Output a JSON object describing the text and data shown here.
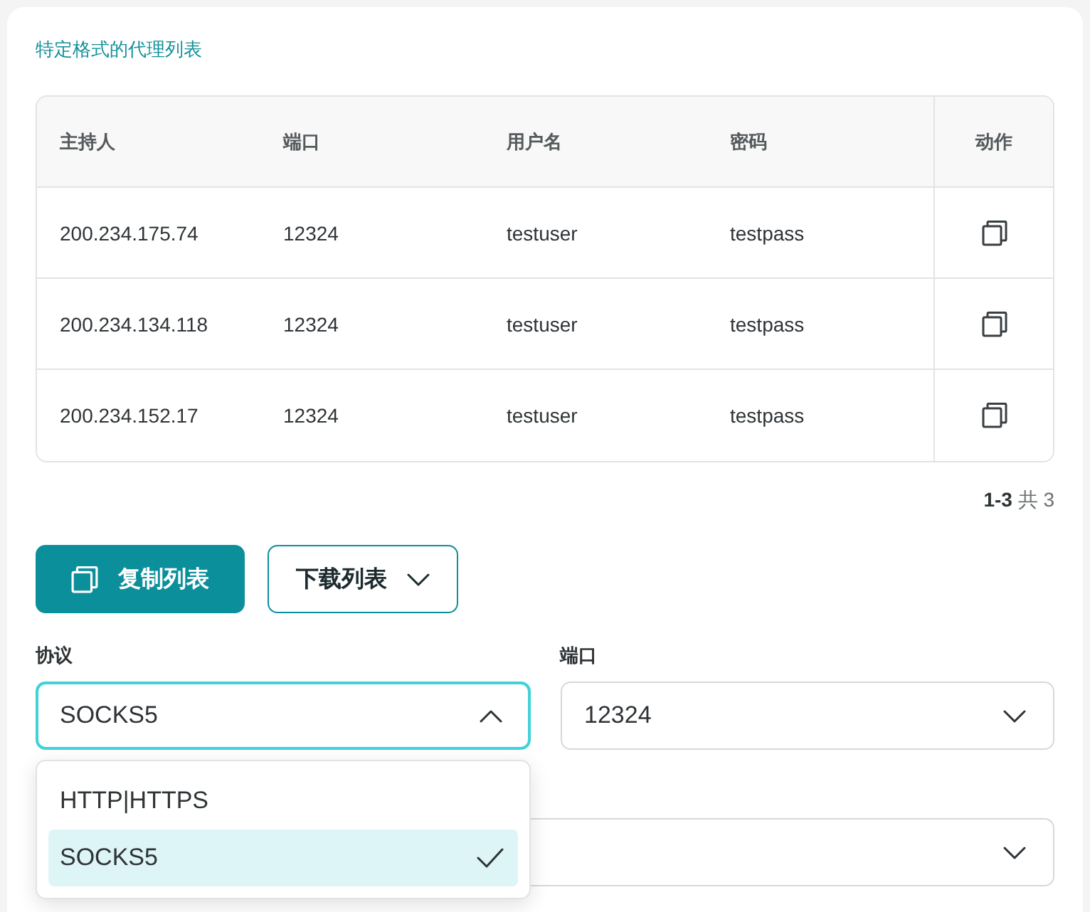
{
  "section_title": "特定格式的代理列表",
  "table": {
    "columns": [
      "主持人",
      "端口",
      "用户名",
      "密码",
      "动作"
    ],
    "rows": [
      {
        "cells": [
          "200.234.175.74",
          "12324",
          "testuser",
          "testpass"
        ]
      },
      {
        "cells": [
          "200.234.134.118",
          "12324",
          "testuser",
          "testpass"
        ]
      },
      {
        "cells": [
          "200.234.152.17",
          "12324",
          "testuser",
          "testpass"
        ]
      }
    ]
  },
  "pagination": "**1-3** 共 3",
  "buttons": [
    {
      "kind": "primary",
      "label": "复制列表"
    },
    {
      "kind": "dropdown",
      "label": "下载列表"
    }
  ],
  "field_rows": [
    [
      {
        "label": "协议",
        "value": "SOCKS5",
        "expanded": true,
        "options": [
          {
            "label": "HTTP|HTTPS",
            "selected": false
          },
          {
            "label": "SOCKS5",
            "selected": true
          }
        ]
      },
      {
        "label": "端口",
        "value": "12324",
        "expanded": false
      }
    ],
    [
      {
        "expanded": false
      }
    ]
  ]
}
